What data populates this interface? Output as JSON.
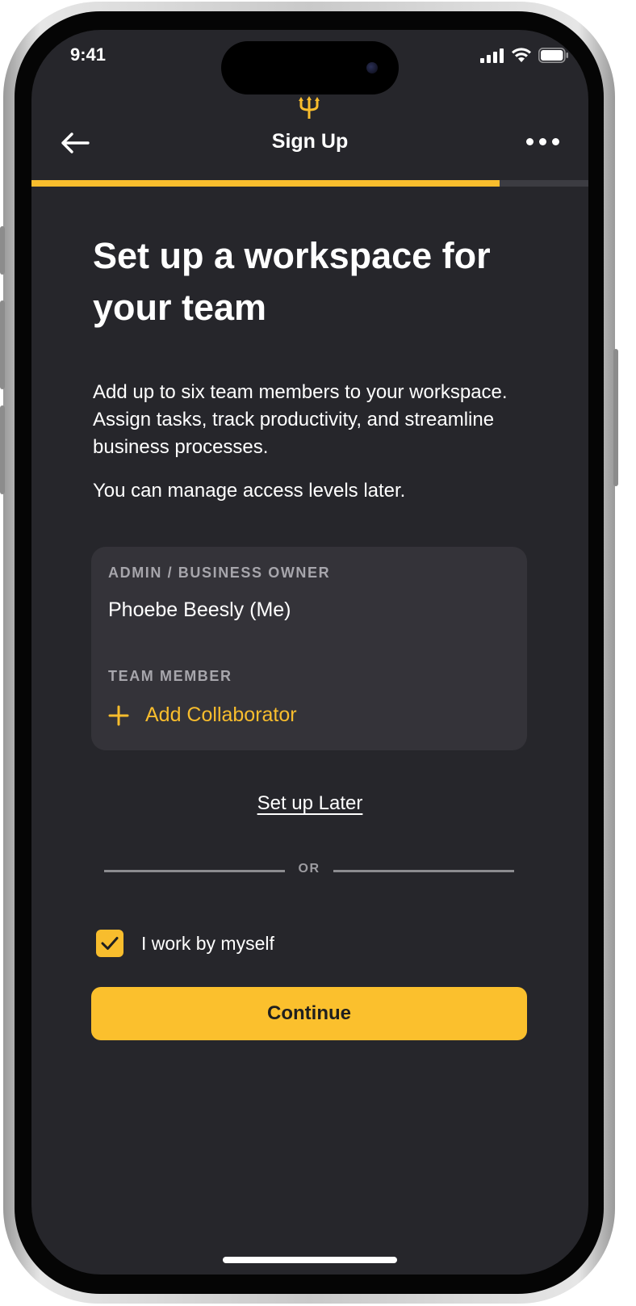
{
  "status_bar": {
    "time": "9:41"
  },
  "header": {
    "title": "Sign Up",
    "progress_percent": 84
  },
  "heading": "Set up a workspace for your team",
  "description": "Add up to six team members to your workspace. Assign tasks, track productivity, and streamline business processes.",
  "description_secondary": "You can manage access levels later.",
  "team_card": {
    "admin_label": "ADMIN / BUSINESS OWNER",
    "admin_name": "Phoebe Beesly (Me)",
    "member_label": "TEAM MEMBER",
    "add_label": "Add Collaborator"
  },
  "setup_later": "Set up Later",
  "divider_text": "OR",
  "solo_checkbox": {
    "label": "I work by myself",
    "checked": true
  },
  "continue_label": "Continue",
  "colors": {
    "accent": "#f8bd2d",
    "background": "#26262b",
    "card": "#343339"
  },
  "icons": [
    "back-arrow-icon",
    "more-icon",
    "trident-logo-icon",
    "signal-icon",
    "wifi-icon",
    "battery-icon",
    "plus-icon",
    "check-icon"
  ]
}
